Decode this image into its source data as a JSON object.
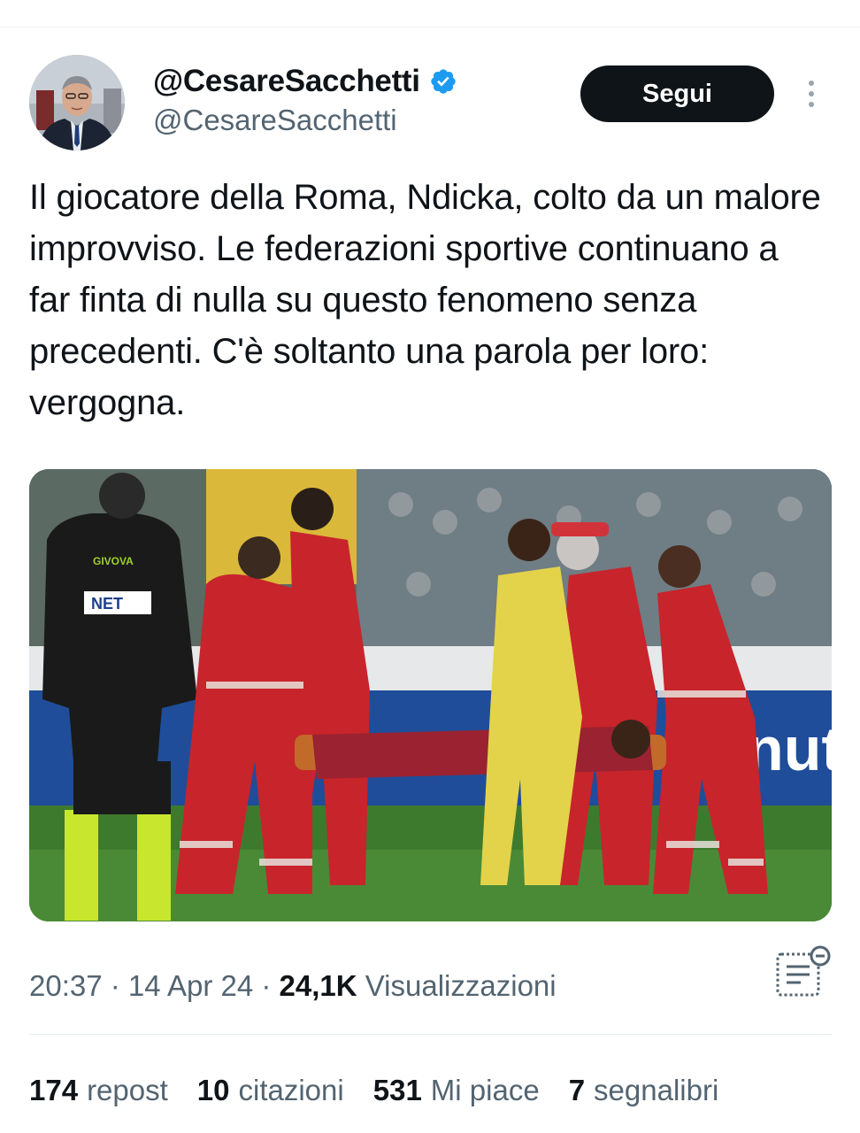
{
  "author": {
    "display_name": "@CesareSacchetti",
    "handle": "@CesareSacchetti",
    "verified": true
  },
  "actions": {
    "follow_label": "Segui",
    "more_icon": "more-vertical-icon"
  },
  "tweet": {
    "text": "Il giocatore della Roma, Ndicka, colto da un malore improvviso. Le federazioni sportive continuano a far finta di nulla su questo fenomeno senza precedenti. C'è soltanto una parola per loro: vergogna."
  },
  "media": {
    "referee_shirt_text": "GIVOVA",
    "referee_sponsor": "NET",
    "billboard_text": "nut"
  },
  "meta": {
    "time": "20:37",
    "separator1": " · ",
    "date": "14 Apr 24",
    "separator2": " · ",
    "views_count": "24,1K",
    "views_label": "Visualizzazioni"
  },
  "stats": {
    "reposts_count": "174",
    "reposts_label": "repost",
    "quotes_count": "10",
    "quotes_label": "citazioni",
    "likes_count": "531",
    "likes_label": "Mi piace",
    "bookmarks_count": "7",
    "bookmarks_label": "segnalibri"
  },
  "colors": {
    "text": "#0f1419",
    "secondary": "#536471",
    "verified": "#1d9bf0",
    "button_bg": "#0f1419",
    "divider": "#eff3f4"
  }
}
